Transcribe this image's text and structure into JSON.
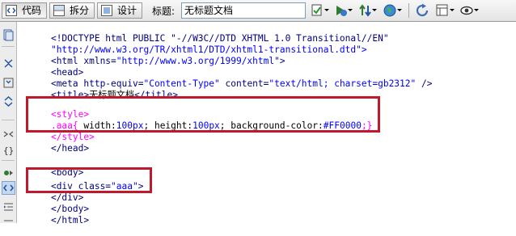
{
  "toolbar": {
    "code_label": "代码",
    "split_label": "拆分",
    "design_label": "设计",
    "title_label": "标题:",
    "title_value": "无标题文档"
  },
  "code_lines": {
    "l1": "<!DOCTYPE html PUBLIC \"-//W3C//DTD XHTML 1.0 Transitional//EN\"",
    "l2": "\"http://www.w3.org/TR/xhtml1/DTD/xhtml1-transitional.dtd\">",
    "l3_a": "<html xmlns=",
    "l3_b": "\"http://www.w3.org/1999/xhtml\"",
    "l3_c": ">",
    "l4": "<head>",
    "l5_a": "<meta http-equiv=",
    "l5_b": "\"Content-Type\"",
    "l5_c": " content=",
    "l5_d": "\"text/html; charset=gb2312\"",
    "l5_e": " />",
    "l6_a": "<title>",
    "l6_b": "无标题文档",
    "l6_c": "</title>",
    "l7": "<style>",
    "l8_a": ".aaa{",
    "l8_b": " width:",
    "l8_c": "100px",
    "l8_d": "; height:",
    "l8_e": "100px",
    "l8_f": "; background-color:",
    "l8_g": "#FF0000",
    "l8_h": ";}",
    "l9": "</style>",
    "l10": "</head>",
    "l12": "<body>",
    "l13_a": "<div class=",
    "l13_b": "\"aaa\"",
    "l13_c": ">",
    "l14": "</div>",
    "l15": "</body>",
    "l16": "</html>"
  },
  "icons": {
    "code_button": "code-view-icon",
    "split_button": "split-view-icon",
    "design_button": "design-view-icon",
    "validate": "check-page-icon",
    "preview": "preview-in-browser-icon",
    "file_management": "file-transfer-icon",
    "globe": "globe-icon",
    "refresh": "refresh-icon",
    "view_options": "view-options-icon",
    "visual_aids": "visual-aids-icon"
  },
  "colors": {
    "highlight_border": "#c0192c",
    "tag": "#000080",
    "attribute_value": "#0000ff",
    "css_selector": "#ff00ff"
  }
}
